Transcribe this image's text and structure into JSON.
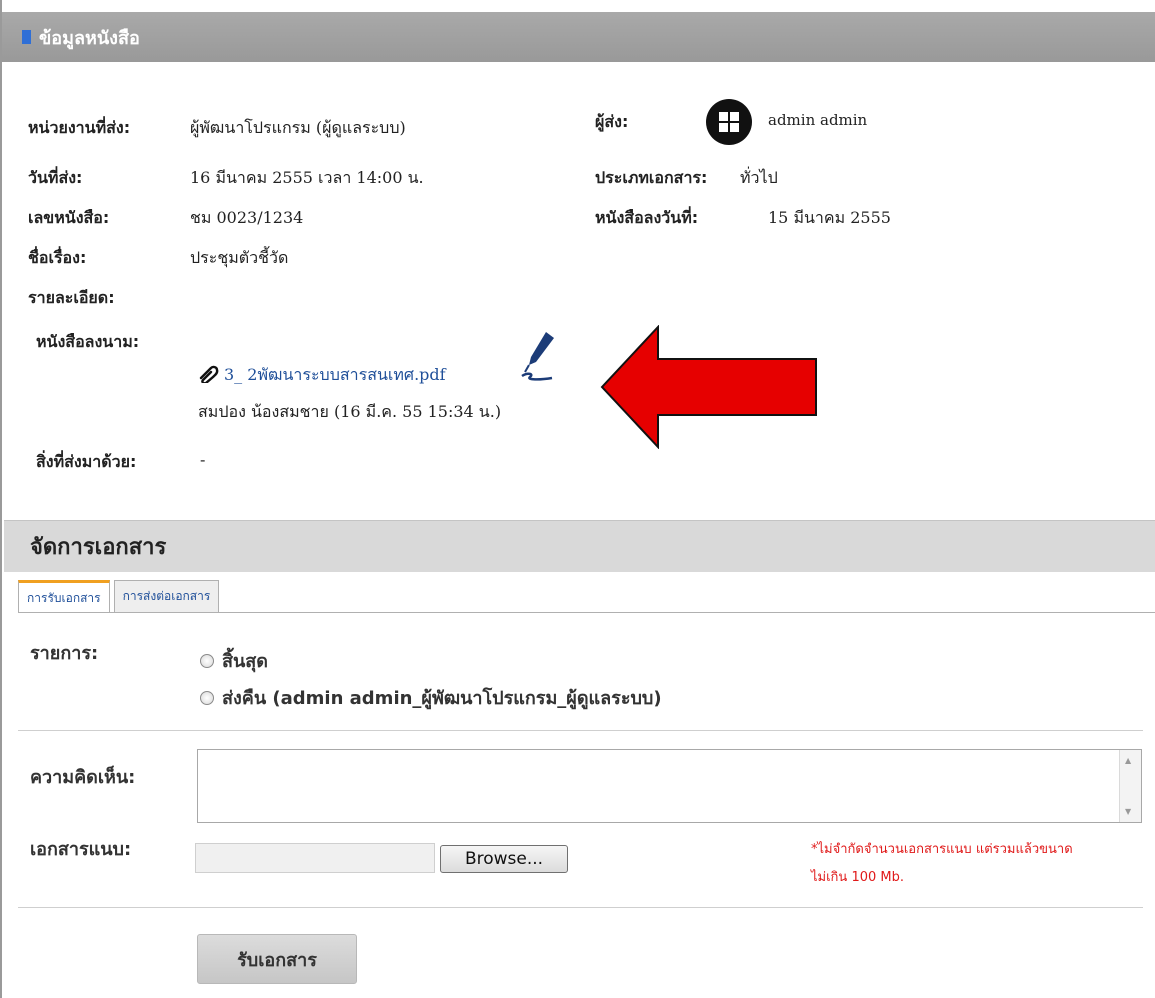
{
  "header": {
    "title": "ข้อมูลหนังสือ"
  },
  "info": {
    "unit_label": "หน่วยงานที่ส่ง:",
    "unit_value": "ผู้พัฒนาโปรแกรม (ผู้ดูแลระบบ)",
    "sender_label": "ผู้ส่ง:",
    "sender_value": "admin admin",
    "date_label": "วันที่ส่ง:",
    "date_value": "16 มีนาคม 2555 เวลา 14:00 น.",
    "doctype_label": "ประเภทเอกสาร:",
    "doctype_value": "ทั่วไป",
    "docno_label": "เลขหนังสือ:",
    "docno_value": "ชม 0023/1234",
    "docdate_label": "หนังสือลงวันที่:",
    "docdate_value": "15 มีนาคม 2555",
    "subject_label": "ชื่อเรื่อง:",
    "subject_value": "ประชุมตัวชี้วัด",
    "detail_label": "รายละเอียด:",
    "signed_label": "หนังสือลงนาม:",
    "attachment_file": "3_ 2พัฒนาระบบสารสนเทศ.pdf",
    "signer_text": "สมปอง น้องสมชาย (16 มี.ค. 55 15:34 น.)",
    "enclosure_label": "สิ่งที่ส่งมาด้วย:",
    "enclosure_value": "-"
  },
  "manage": {
    "title": "จัดการเอกสาร",
    "tabs": [
      {
        "label": "การรับเอกสาร",
        "active": true
      },
      {
        "label": "การส่งต่อเอกสาร",
        "active": false
      }
    ],
    "list_label": "รายการ:",
    "options": [
      "สิ้นสุด",
      "ส่งคืน (admin admin_ผู้พัฒนาโปรแกรม_ผู้ดูแลระบบ)"
    ],
    "comment_label": "ความคิดเห็น:",
    "comment_value": "",
    "attach_label": "เอกสารแนบ:",
    "browse_label": "Browse...",
    "note_line1": "*ไม่จำกัดจำนวนเอกสารแนบ แต่รวมแล้วขนาด",
    "note_line2": "ไม่เกิน 100 Mb.",
    "submit_label": "รับเอกสาร"
  },
  "colors": {
    "header_bar": "#a3a3a3",
    "link": "#1f4f99",
    "arrow": "#e60000",
    "note": "#e01919",
    "tab_accent": "#f0a020"
  },
  "icons": {
    "header_marker": "blue-square-icon",
    "avatar": "windows-avatar-icon",
    "attachment": "paperclip-icon",
    "signature": "pen-signature-icon",
    "pointer": "red-arrow-icon"
  }
}
